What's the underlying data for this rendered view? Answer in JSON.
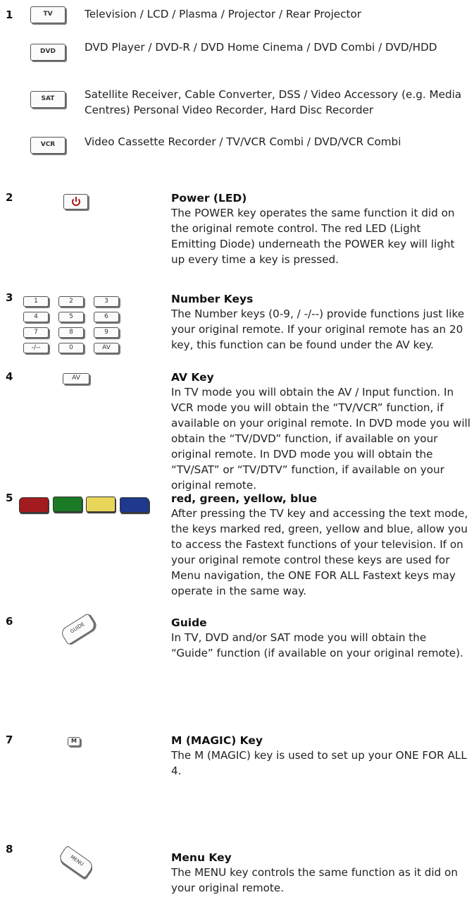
{
  "section1": {
    "number": "1",
    "devices": [
      {
        "key": "TV",
        "text": "Television / LCD / Plasma / Projector / Rear Projector"
      },
      {
        "key": "DVD",
        "text": "DVD Player / DVD-R / DVD Home Cinema / DVD Combi / DVD/HDD"
      },
      {
        "key": "SAT",
        "text": "Satellite Receiver, Cable Converter, DSS / Video Accessory (e.g. Media Centres) Personal Video Recorder, Hard Disc Recorder"
      },
      {
        "key": "VCR",
        "text": "Video Cassette Recorder / TV/VCR Combi / DVD/VCR Combi"
      }
    ]
  },
  "section2": {
    "number": "2",
    "title": "Power (LED)",
    "text": "The POWER key operates the same function it did on the original remote control. The red LED (Light Emitting Diode) underneath the POWER key will light up every time a key is pressed."
  },
  "section3": {
    "number": "3",
    "title": "Number Keys",
    "text": "The Number keys (0-9, / -/--) provide functions just like your original remote. If your original remote has an 20 key, this function can be found under the AV key.",
    "keys": [
      "1",
      "2",
      "3",
      "4",
      "5",
      "6",
      "7",
      "8",
      "9",
      "-/--",
      "0",
      "AV"
    ]
  },
  "section4": {
    "number": "4",
    "key": "AV",
    "title": "AV Key",
    "text": "In TV mode you will obtain the AV / Input function. In VCR mode you will obtain the “TV/VCR” function, if available on your original remote. In DVD mode you will obtain the “TV/DVD” function, if available on your original remote. In DVD mode you will obtain the “TV/SAT” or “TV/DTV” function, if available on your original remote."
  },
  "section5": {
    "number": "5",
    "title": "red, green, yellow, blue",
    "text": "After pressing the TV key and accessing the text mode, the keys marked red, green, yellow and blue, allow you to access the Fastext functions of your television. If on your original remote control these keys are used for Menu navigation, the ONE FOR ALL Fastext keys may operate in the same way.",
    "colors": [
      "#a31b1f",
      "#1a7a25",
      "#e8d65a",
      "#1f3a8c"
    ]
  },
  "section6": {
    "number": "6",
    "key": "GUIDE",
    "title": "Guide",
    "text": "In TV, DVD and/or SAT mode you will obtain the “Guide” function (if available on your original remote)."
  },
  "section7": {
    "number": "7",
    "key": "M",
    "title": "M (MAGIC) Key",
    "text": "The M (MAGIC) key is used to set up your ONE FOR ALL 4."
  },
  "section8": {
    "number": "8",
    "key": "MENU",
    "title": "Menu Key",
    "text": "The MENU key controls the same function as it did on your original remote."
  }
}
